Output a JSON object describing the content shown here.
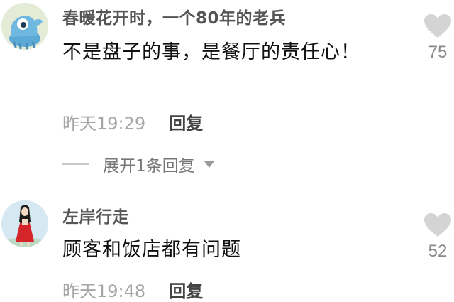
{
  "comments": [
    {
      "username": "春暖花开时，一个80年的老兵",
      "content": "不是盘子的事，是餐厅的责任心！",
      "time": "昨天19:29",
      "reply_label": "回复",
      "likes": "75",
      "expand_label": "展开1条回复",
      "avatar_icon": "blue-cartoon-avatar-icon"
    },
    {
      "username": "左岸行走",
      "content": "顾客和饭店都有问题",
      "time": "昨天19:48",
      "reply_label": "回复",
      "likes": "52",
      "avatar_icon": "girl-red-dress-avatar-icon"
    }
  ],
  "icons": {
    "like": "heart-icon",
    "expand": "caret-down-icon"
  },
  "colors": {
    "heart": "#d4d4d4",
    "time_text": "#a6a6a6",
    "avatar_1_bg": "#dfe8d2",
    "avatar_2_bg": "#cfe3ef"
  }
}
